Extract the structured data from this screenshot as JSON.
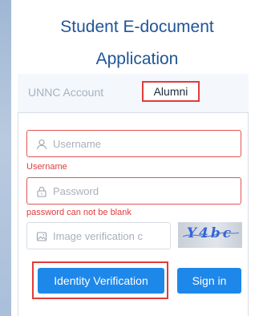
{
  "page": {
    "title_line1": "Student E-document",
    "title_line2": "Application"
  },
  "tabs": [
    {
      "label": "UNNC Account",
      "active": false
    },
    {
      "label": "Alumni",
      "active": true
    }
  ],
  "form": {
    "username": {
      "placeholder": "Username",
      "value": "",
      "error": "Username",
      "icon": "user-icon"
    },
    "password": {
      "placeholder": "Password",
      "value": "",
      "error": "password can not be blank",
      "icon": "lock-icon"
    },
    "captcha": {
      "placeholder": "Image verification c",
      "value": "",
      "icon": "image-icon",
      "image_text": "Y4bc"
    }
  },
  "buttons": {
    "identity_verification": "Identity Verification",
    "sign_in": "Sign in"
  },
  "colors": {
    "title": "#1f5597",
    "primary": "#1e88ea",
    "error": "#e23b3b"
  }
}
